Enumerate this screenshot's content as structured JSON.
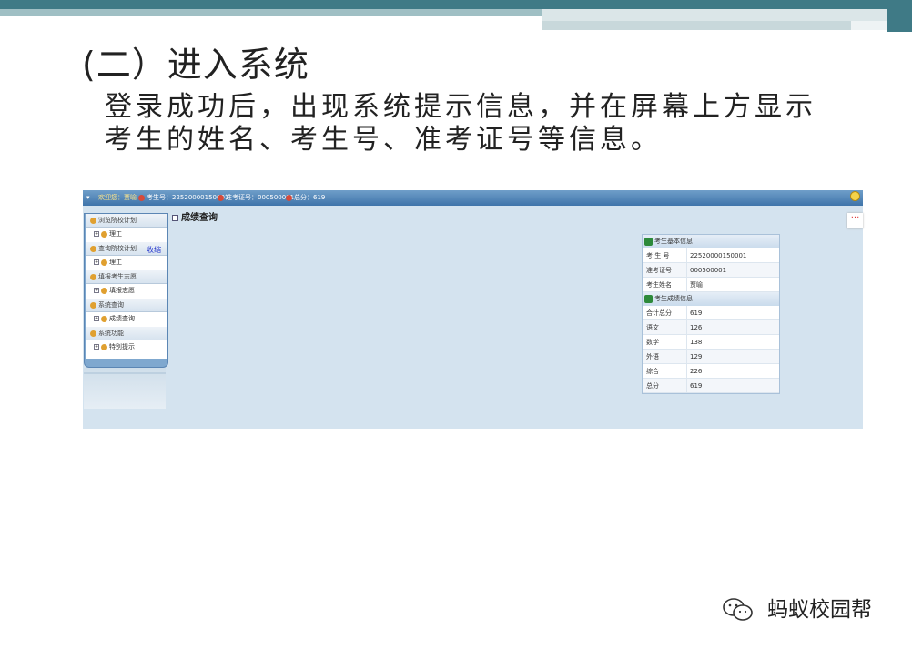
{
  "slide": {
    "title": "(二）进入系统",
    "body": "登录成功后，出现系统提示信息，并在屏幕上方显示考生的姓名、考生号、准考证号等信息。",
    "watermark": "蚂蚁校园帮"
  },
  "app": {
    "topbar": {
      "welcome": "欢迎您：贾喻",
      "candidate_no": "考生号：22520000150001",
      "admission_no": "准考证号：000500001",
      "total_score": "总分：619"
    },
    "sidebar": {
      "collapse_label": "收缩",
      "groups": [
        {
          "label": "浏览院校计划",
          "items": [
            "理工"
          ]
        },
        {
          "label": "查询院校计划",
          "items": [
            "理工"
          ]
        },
        {
          "label": "填报考生志愿",
          "items": [
            "填报志愿"
          ]
        },
        {
          "label": "系统查询",
          "items": [
            "成绩查询"
          ]
        },
        {
          "label": "系统功能",
          "items": [
            "特别提示"
          ]
        }
      ]
    },
    "content_title": "成绩查询",
    "info_panel": {
      "basic_header": "考生基本信息",
      "basic_rows": [
        {
          "key": "考 生 号",
          "value": "22520000150001"
        },
        {
          "key": "准考证号",
          "value": "000500001"
        },
        {
          "key": "考生姓名",
          "value": "贾喻"
        }
      ],
      "score_header": "考生成绩信息",
      "score_rows": [
        {
          "key": "合计总分",
          "value": "619"
        },
        {
          "key": "语文",
          "value": "126"
        },
        {
          "key": "数学",
          "value": "138"
        },
        {
          "key": "外语",
          "value": "129"
        },
        {
          "key": "综合",
          "value": "226"
        },
        {
          "key": "总分",
          "value": "619"
        }
      ]
    },
    "right_icons": [
      "bulb-icon",
      "more-icon"
    ]
  },
  "colors": {
    "accent_band": "#3f7a86",
    "app_topbar": "#3f74aa",
    "app_background": "#d4e3ef"
  }
}
